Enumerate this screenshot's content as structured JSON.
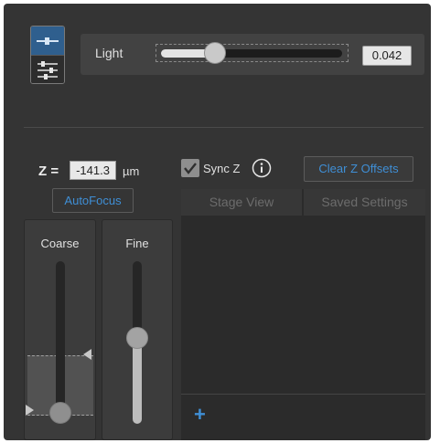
{
  "light": {
    "label": "Light",
    "value": "0.042",
    "slider_fraction": 0.3
  },
  "z": {
    "label": "Z =",
    "value": "-141.3",
    "unit": "µm",
    "autofocus_label": "AutoFocus"
  },
  "sync": {
    "label": "Sync Z",
    "checked": true
  },
  "clear_offsets_label": "Clear Z Offsets",
  "sliders": {
    "coarse_label": "Coarse",
    "fine_label": "Fine",
    "fine_fraction": 0.53
  },
  "tabs": {
    "stage_view": "Stage View",
    "saved_settings": "Saved Settings"
  },
  "add_label": "+",
  "colors": {
    "accent": "#3f8fd6",
    "panel_bg": "#343434"
  },
  "icons": {
    "mode_top": "slider-single-icon",
    "mode_bottom": "sliders-multi-icon",
    "info": "info-icon",
    "check": "check-icon"
  }
}
